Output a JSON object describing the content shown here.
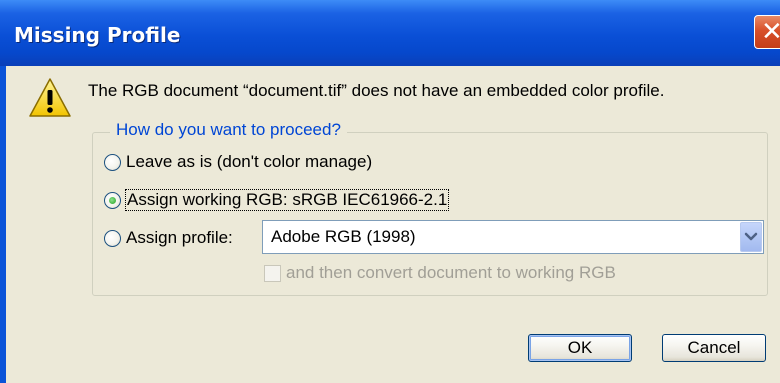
{
  "window": {
    "title": "Missing Profile",
    "close_glyph": "✕"
  },
  "dialog": {
    "message": "The RGB document “document.tif” does not have an embedded color profile.",
    "icon": "warning-icon",
    "group_legend": "How do you want to proceed?",
    "options": [
      {
        "label": "Leave as is (don't color manage)",
        "checked": false
      },
      {
        "label": "Assign working RGB:  sRGB IEC61966-2.1",
        "checked": true
      },
      {
        "label": "Assign profile:",
        "checked": false
      }
    ],
    "profile_select": {
      "value": "Adobe RGB (1998)"
    },
    "convert_checkbox": {
      "label": "and then convert document to working RGB",
      "checked": false,
      "enabled": false
    },
    "buttons": {
      "ok": "OK",
      "cancel": "Cancel"
    }
  },
  "colors": {
    "titlebar": "#0a4fd6",
    "dialog_bg": "#ece9d8",
    "legend_text": "#0046d5",
    "close_button": "#d8502a"
  }
}
